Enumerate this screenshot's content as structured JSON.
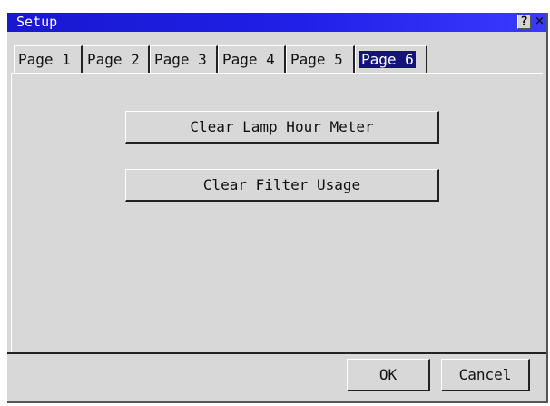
{
  "window": {
    "title": "Setup",
    "help_label": "?",
    "close_label": "×"
  },
  "tabs": [
    {
      "label": "Page 1"
    },
    {
      "label": "Page 2"
    },
    {
      "label": "Page 3"
    },
    {
      "label": "Page 4"
    },
    {
      "label": "Page 5"
    },
    {
      "label": "Page 6",
      "active": true
    }
  ],
  "actions": {
    "clear_lamp": "Clear Lamp Hour Meter",
    "clear_filter": "Clear Filter Usage"
  },
  "footer": {
    "ok": "OK",
    "cancel": "Cancel"
  },
  "colors": {
    "titlebar": "#2020e8",
    "active_tab": "#13137a",
    "face": "#d8d8d8"
  }
}
